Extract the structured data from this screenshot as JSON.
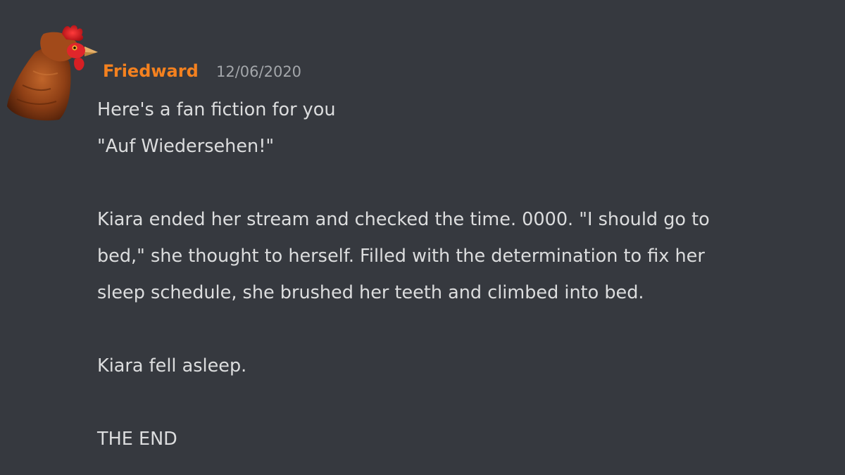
{
  "message": {
    "author": "Friedward",
    "author_color": "#f4811f",
    "timestamp": "12/06/2020",
    "avatar_icon": "chicken-avatar",
    "lines": [
      "Here's a fan fiction for you",
      "\"Auf Wiedersehen!\"",
      "Kiara ended her stream and checked the time. 0000. \"I should go to",
      "bed,\" she thought to herself. Filled with the determination to fix her",
      "sleep schedule, she brushed her teeth and climbed into bed.",
      "Kiara fell asleep.",
      "THE END"
    ]
  },
  "theme": {
    "background": "#36393f",
    "text": "#dcddde",
    "muted": "#a3a6aa"
  }
}
